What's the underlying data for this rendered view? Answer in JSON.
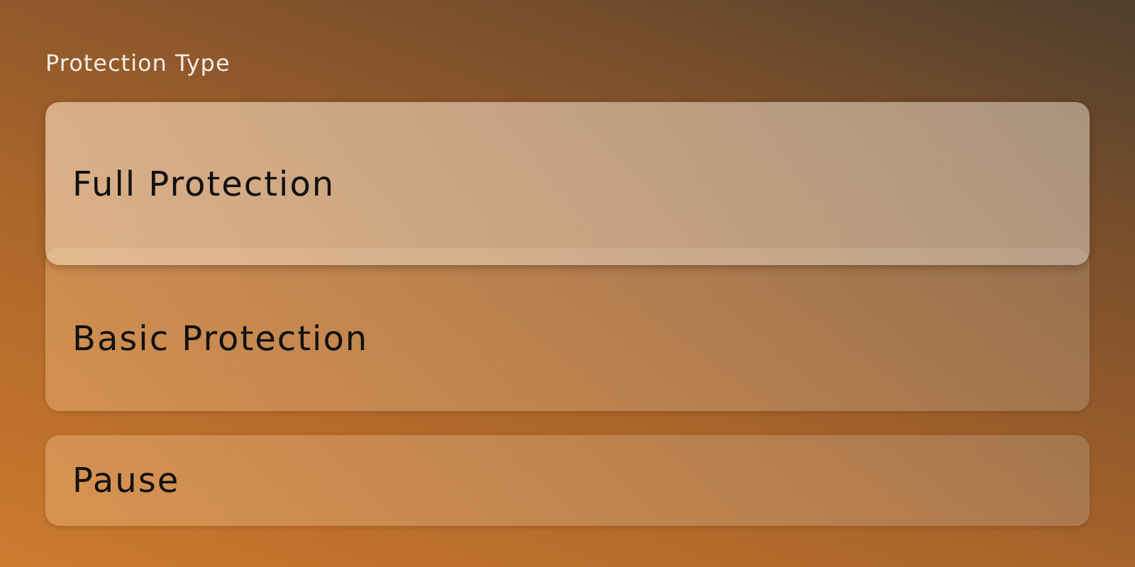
{
  "section_label": "Protection Type",
  "groups": [
    {
      "options": [
        {
          "label": "Full Protection",
          "selected": true,
          "kind": "large"
        },
        {
          "label": "Basic Protection",
          "selected": false,
          "kind": "large"
        }
      ]
    },
    {
      "options": [
        {
          "label": "Pause",
          "selected": false,
          "kind": "compact"
        }
      ]
    }
  ]
}
